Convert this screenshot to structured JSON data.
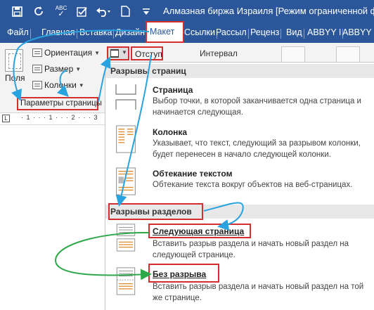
{
  "window": {
    "title": "Алмазная  биржа Израиля [Режим ограниченной фу",
    "qat": [
      {
        "name": "save-icon",
        "glyph": "💾"
      },
      {
        "name": "refresh-icon",
        "glyph": "↻"
      },
      {
        "name": "spelling-icon",
        "glyph": "ABC"
      },
      {
        "name": "check-icon",
        "glyph": "✓"
      },
      {
        "name": "undo-icon",
        "glyph": "↶"
      },
      {
        "name": "new-document-icon",
        "glyph": "▯"
      },
      {
        "name": "more-icon",
        "glyph": "▾"
      }
    ]
  },
  "tabs": [
    {
      "label": "Файл",
      "active": false
    },
    {
      "label": "Главная",
      "active": false
    },
    {
      "label": "Вставка",
      "active": false
    },
    {
      "label": "Дизайн",
      "active": false
    },
    {
      "label": "Макет",
      "active": true
    },
    {
      "label": "Ссылки",
      "active": false
    },
    {
      "label": "Рассыл",
      "active": false
    },
    {
      "label": "Реценз",
      "active": false
    },
    {
      "label": "Вид",
      "active": false
    },
    {
      "label": "ABBYY I",
      "active": false
    },
    {
      "label": "ABBYY F",
      "active": false
    }
  ],
  "ribbon": {
    "fields": "Поля",
    "orientation": "Ориентация",
    "size": "Размер",
    "columns": "Колонки",
    "group_label": "Параметры страницы",
    "indent": "Отступ",
    "spacing": "Интервал"
  },
  "ruler": {
    "corner": "L",
    "text": "· 1 · · · 1 · · · 2 · · · 3"
  },
  "dropdown": {
    "page_breaks_header": "Разрывы страниц",
    "section_breaks_header": "Разрывы разделов",
    "items": [
      {
        "title": "Страница",
        "desc": "Выбор точки, в которой заканчивается одна страница и начинается следующая."
      },
      {
        "title": "Колонка",
        "desc": "Указывает, что текст, следующий за разрывом колонки, будет перенесен в начало следующей колонки."
      },
      {
        "title": "Обтекание текстом",
        "desc": "Обтекание текста вокруг объектов на веб-страницах."
      },
      {
        "title": "Следующая страница",
        "desc": "Вставить разрыв раздела и начать новый раздел на следующей странице."
      },
      {
        "title": "Без разрыва",
        "desc": "Вставить разрыв раздела и начать новый раздел на той же странице."
      }
    ]
  },
  "colors": {
    "ribbon_blue": "#2b579a",
    "highlight_red": "#d32f2f",
    "arrow_blue": "#29a3e0",
    "arrow_green": "#2ea84a"
  }
}
